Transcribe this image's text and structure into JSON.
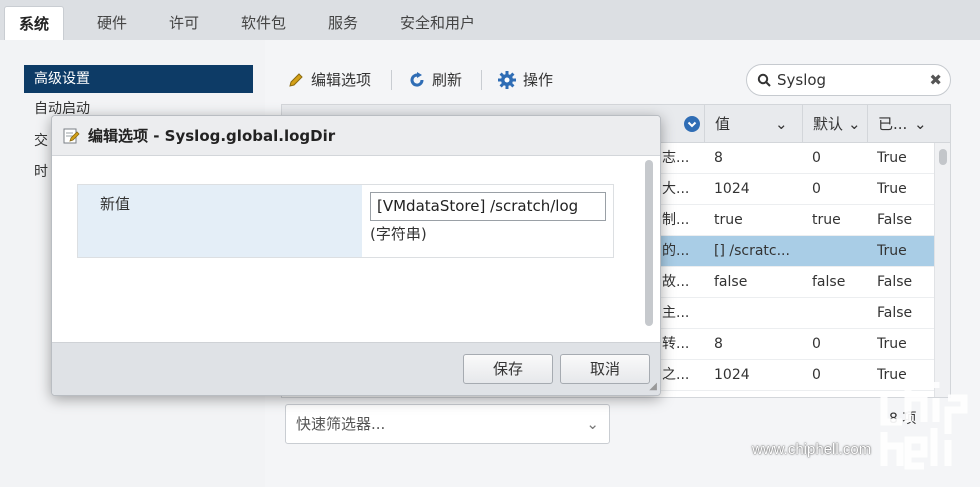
{
  "tabs": [
    {
      "label": "系统",
      "active": true
    },
    {
      "label": "硬件"
    },
    {
      "label": "许可"
    },
    {
      "label": "软件包"
    },
    {
      "label": "服务"
    },
    {
      "label": "安全和用户"
    }
  ],
  "sidebar": {
    "items": [
      {
        "label": "高级设置",
        "active": true
      },
      {
        "label": "自动启动"
      },
      {
        "label": "交"
      },
      {
        "label": "时"
      }
    ]
  },
  "toolbar": {
    "edit_label": "编辑选项",
    "refresh_label": "刷新",
    "actions_label": "操作"
  },
  "search": {
    "value": "Syslog"
  },
  "grid": {
    "columns": {
      "value": "值",
      "default": "默认",
      "overridden": "已..."
    },
    "rows": [
      {
        "desc": "志...",
        "value": "8",
        "default": "0",
        "overridden": "True"
      },
      {
        "desc": "大...",
        "value": "1024",
        "default": "0",
        "overridden": "True"
      },
      {
        "desc": "制...",
        "value": "true",
        "default": "true",
        "overridden": "False"
      },
      {
        "desc": "的...",
        "value": "[] /scratc...",
        "default": "",
        "overridden": "True",
        "selected": true
      },
      {
        "desc": "故...",
        "value": "false",
        "default": "false",
        "overridden": "False"
      },
      {
        "desc": "主...",
        "value": "",
        "default": "",
        "overridden": "False"
      },
      {
        "desc": "转...",
        "value": "8",
        "default": "0",
        "overridden": "True"
      },
      {
        "desc": "之...",
        "value": "1024",
        "default": "0",
        "overridden": "True"
      }
    ],
    "count_fragment": "8 项"
  },
  "filter": {
    "placeholder": "快速筛选器..."
  },
  "modal": {
    "title": "编辑选项 - Syslog.global.logDir",
    "field_label": "新值",
    "field_value": "[VMdataStore] /scratch/log",
    "field_hint": "(字符串)",
    "save_label": "保存",
    "cancel_label": "取消"
  },
  "watermark": {
    "text": "www.chiphell.com"
  },
  "colors": {
    "sidebar_active": "#0d3b66",
    "row_selected": "#a9cde6",
    "accent_icon": "#2f6db5"
  }
}
